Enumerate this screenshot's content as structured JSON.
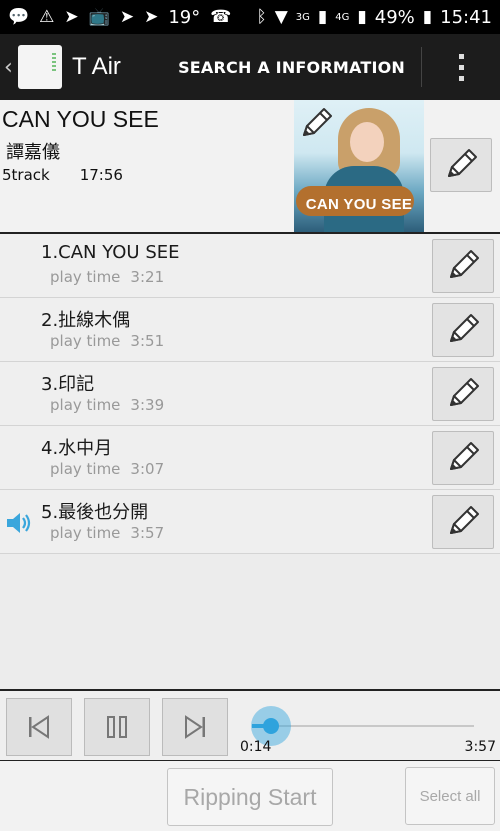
{
  "status_bar": {
    "temperature": "19°",
    "battery": "49%",
    "time": "15:41",
    "net_3g": "3G",
    "net_4g": "4G"
  },
  "action_bar": {
    "title": "T Air",
    "search_label": "SEARCH A INFORMATION"
  },
  "album": {
    "title": "CAN YOU SEE",
    "artist": "譚嘉儀",
    "track_count": "5track",
    "total_time": "17:56",
    "cover_text": "CAN YOU SEE"
  },
  "tracks": [
    {
      "name": "1.CAN YOU SEE",
      "play_label": "play time",
      "time": "3:21",
      "playing": false
    },
    {
      "name": "2.扯線木偶",
      "play_label": "play time",
      "time": "3:51",
      "playing": false
    },
    {
      "name": "3.印記",
      "play_label": "play time",
      "time": "3:39",
      "playing": false
    },
    {
      "name": "4.水中月",
      "play_label": "play time",
      "time": "3:07",
      "playing": false
    },
    {
      "name": "5.最後也分開",
      "play_label": "play time",
      "time": "3:57",
      "playing": true
    }
  ],
  "player": {
    "current_time": "0:14",
    "total_time": "3:57",
    "progress_fraction": 0.06,
    "accent_color": "#2fa3dd"
  },
  "footer": {
    "ripping_label": "Ripping Start",
    "select_all_label": "Select all"
  }
}
